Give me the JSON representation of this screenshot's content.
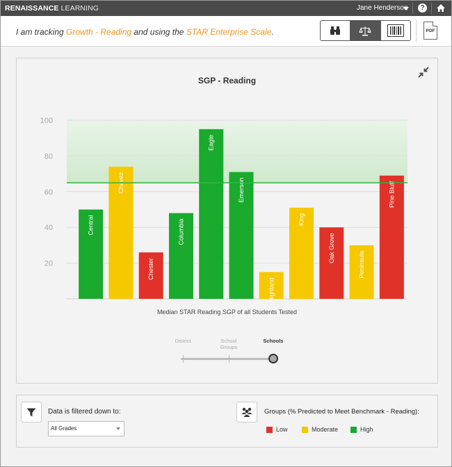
{
  "topbar": {
    "logo_bold": "RENAISSANCE",
    "logo_thin": "LEARNING",
    "user_name": "Jane Henderson",
    "help_label": "?"
  },
  "header": {
    "prefix": "I am tracking ",
    "focus": "Growth - Reading",
    "middle": " and using the ",
    "scale": "STAR Enterprise Scale",
    "suffix": ".",
    "pdf_label": "PDF",
    "view_buttons": [
      "binoculars-icon",
      "scale-icon",
      "barcode-icon"
    ],
    "active_view": "scale-icon"
  },
  "chart_data": {
    "type": "bar",
    "title": "SGP - Reading",
    "xlabel": "Median STAR Reading SGP of all Students Tested",
    "ylabel": "",
    "ylim": [
      0,
      100
    ],
    "yticks": [
      20,
      40,
      60,
      80,
      100
    ],
    "benchmark_line": 65,
    "benchmark_band": [
      65,
      100
    ],
    "categories": [
      "Central",
      "Chavez",
      "Chester",
      "Columbia",
      "Eagle",
      "Emerson",
      "Highland",
      "King",
      "Oak Grove",
      "Peninsula",
      "Pine Bluff"
    ],
    "values": [
      50,
      74,
      26,
      48,
      95,
      71,
      15,
      51,
      40,
      30,
      69
    ],
    "groups": [
      "High",
      "Moderate",
      "Low",
      "High",
      "High",
      "High",
      "Moderate",
      "Moderate",
      "Low",
      "Moderate",
      "Low"
    ],
    "colors": {
      "Low": "#e03228",
      "Moderate": "#f5c800",
      "High": "#1aaa2e",
      "benchmark": "#2fb33d"
    }
  },
  "slider": {
    "levels": [
      {
        "line1": "",
        "line2": "District"
      },
      {
        "line1": "School",
        "line2": "Groups"
      },
      {
        "line1": "",
        "line2": "Schools"
      }
    ],
    "selected": "Schools"
  },
  "filters": {
    "filtered_label": "Data is filtered down to:",
    "grade_value": "All Grades",
    "groups_label": "Groups (% Predicted to Meet Benchmark -  Reading):",
    "legend": [
      {
        "label": "Low",
        "color": "#e03228"
      },
      {
        "label": "Moderate",
        "color": "#f5c800"
      },
      {
        "label": "High",
        "color": "#1aaa2e"
      }
    ]
  }
}
